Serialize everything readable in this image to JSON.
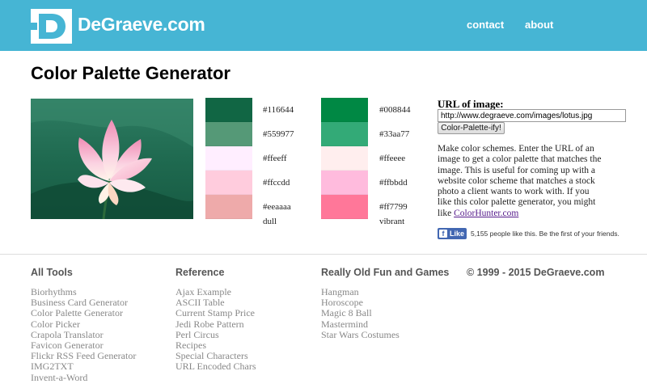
{
  "header": {
    "logo_text": "DeGraeve.com",
    "brand_color": "#46b5d4",
    "nav": [
      "contact",
      "about"
    ]
  },
  "page_title": "Color Palette Generator",
  "image": {
    "subject": "pink lotus flower on green leaves"
  },
  "palettes": {
    "dull": {
      "label": "dull",
      "colors": [
        "#116644",
        "#559977",
        "#ffeeff",
        "#ffccdd",
        "#eeaaaa"
      ]
    },
    "vibrant": {
      "label": "vibrant",
      "colors": [
        "#008844",
        "#33aa77",
        "#ffeeee",
        "#ffbbdd",
        "#ff7799"
      ]
    }
  },
  "form": {
    "url_label": "URL of image:",
    "url_value": "http://www.degraeve.com/images/lotus.jpg",
    "submit_label": "Color-Palette-ify!"
  },
  "description": {
    "text": "Make color schemes. Enter the URL of an image to get a color palette that matches the image. This is useful for coming up with a website color scheme that matches a stock photo a client wants to work with. If you like this color palette generator, you might like ",
    "link_text": "ColorHunter.com"
  },
  "facebook": {
    "like_label": "Like",
    "like_text": "5,155 people like this. Be the first of your friends."
  },
  "footer": {
    "all_tools": {
      "heading": "All Tools",
      "links": [
        "Biorhythms",
        "Business Card Generator",
        "Color Palette Generator",
        "Color Picker",
        "Crapola Translator",
        "Favicon Generator",
        "Flickr RSS Feed Generator",
        "IMG2TXT",
        "Invent-a-Word"
      ]
    },
    "reference": {
      "heading": "Reference",
      "links": [
        "Ajax Example",
        "ASCII Table",
        "Current Stamp Price",
        "Jedi Robe Pattern",
        "Perl Circus",
        "Recipes",
        "Special Characters",
        "URL Encoded Chars"
      ]
    },
    "games": {
      "heading": "Really Old Fun and Games",
      "links": [
        "Hangman",
        "Horoscope",
        "Magic 8 Ball",
        "Mastermind",
        "Star Wars Costumes"
      ]
    },
    "copyright": "© 1999 - 2015 DeGraeve.com"
  }
}
